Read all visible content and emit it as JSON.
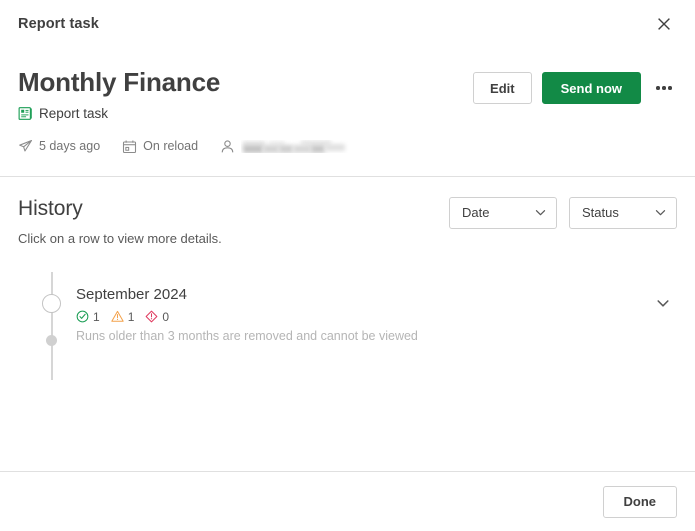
{
  "window": {
    "title": "Report task",
    "close_icon": "close-icon"
  },
  "header": {
    "doc_title": "Monthly Finance",
    "subtitle": "Report task",
    "subtitle_icon": "report-task-icon",
    "actions": {
      "edit_label": "Edit",
      "send_now_label": "Send now",
      "more_icon": "ellipsis-icon"
    },
    "meta": [
      {
        "icon": "send-plane-icon",
        "text": "5 days ago"
      },
      {
        "icon": "calendar-icon",
        "text": "On reload"
      },
      {
        "icon": "user-icon",
        "text": ""
      }
    ]
  },
  "history": {
    "title": "History",
    "hint": "Click on a row to view more details.",
    "filters": [
      {
        "name": "date-filter",
        "value": "Date",
        "icon": "chevron-down-icon"
      },
      {
        "name": "status-filter",
        "value": "Status",
        "icon": "chevron-down-icon"
      }
    ],
    "rows": [
      {
        "label": "September 2024",
        "counts": [
          {
            "icon": "check-circle-icon",
            "value": "1",
            "color": "#1a9d54"
          },
          {
            "icon": "warning-triangle-icon",
            "value": "1",
            "color": "#f4a24b"
          },
          {
            "icon": "error-diamond-icon",
            "value": "0",
            "color": "#e03a5f"
          }
        ],
        "expand_icon": "chevron-down-icon"
      }
    ],
    "note": "Runs older than 3 months are removed and cannot be viewed"
  },
  "footer": {
    "done_label": "Done"
  },
  "colors": {
    "primary_green": "#128a46",
    "success": "#1a9d54",
    "warning": "#f4a24b",
    "error": "#e03a5f",
    "text": "#404040",
    "muted": "#737373",
    "divider": "#e0e0e0"
  }
}
